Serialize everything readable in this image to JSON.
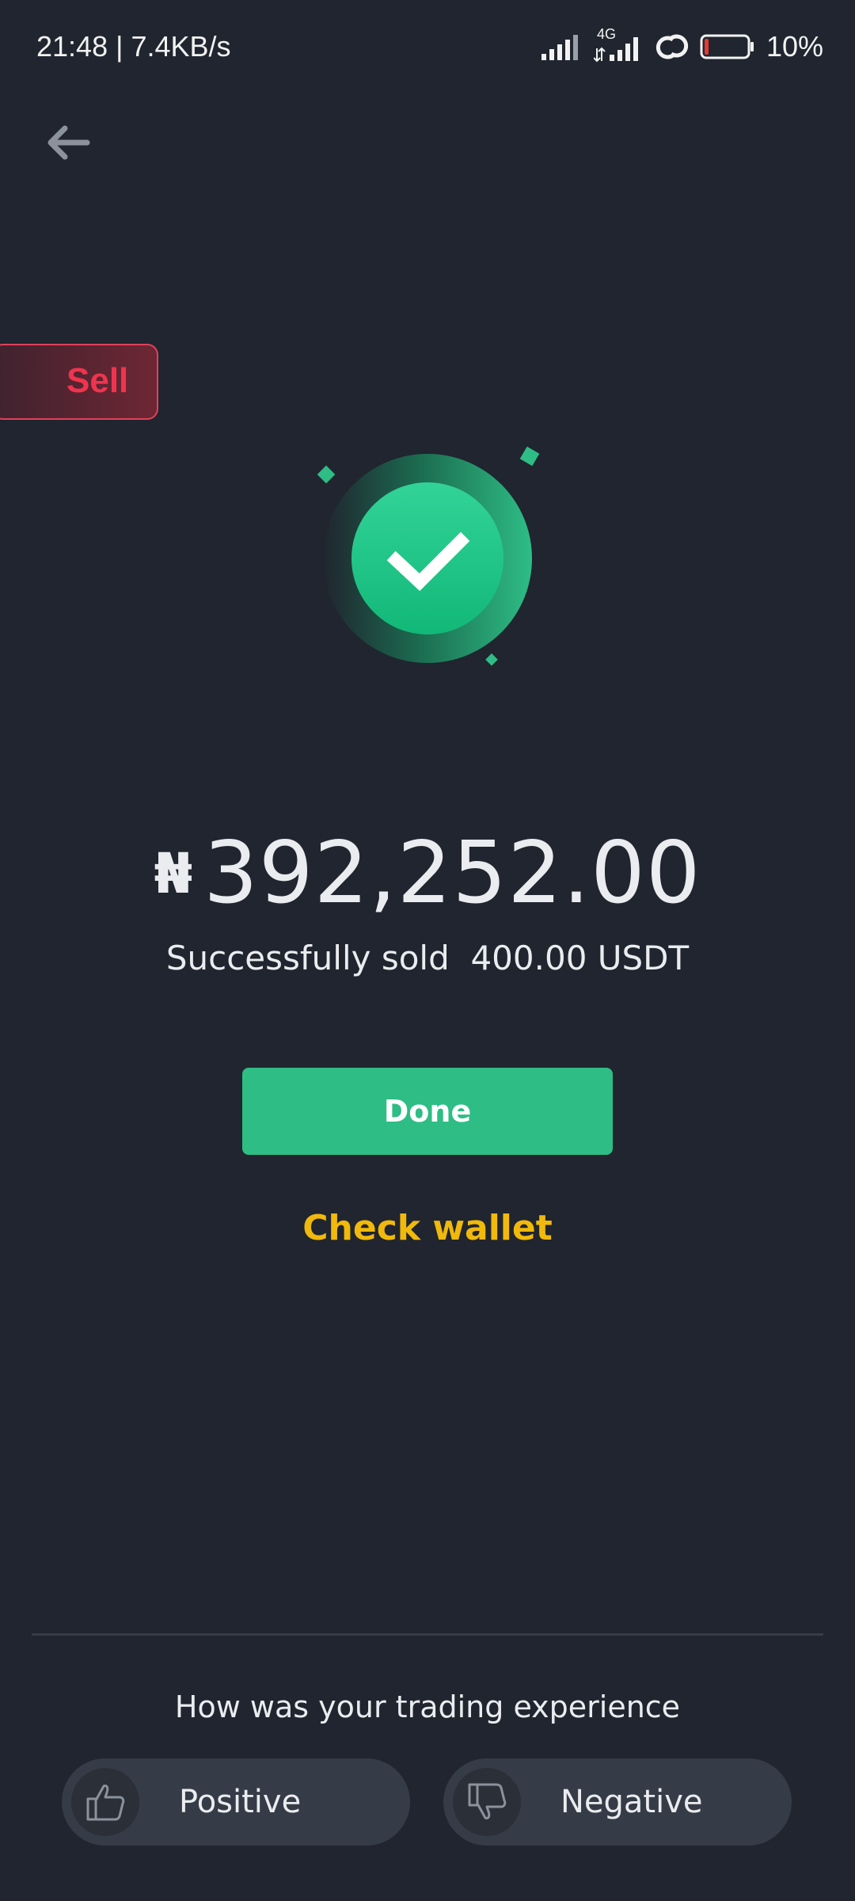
{
  "status_bar": {
    "time_speed": "21:48 | 7.4KB/s",
    "network": "4G",
    "battery": "10%"
  },
  "tag": {
    "label": "Sell"
  },
  "result": {
    "currency_symbol": "₦",
    "amount": "392,252.00",
    "message": "Successfully sold  400.00 USDT"
  },
  "actions": {
    "done_label": "Done",
    "check_wallet_label": "Check wallet"
  },
  "feedback": {
    "question": "How was your trading experience",
    "positive_label": "Positive",
    "negative_label": "Negative"
  },
  "colors": {
    "background": "#20252f",
    "success_green": "#2ebd85",
    "accent_yellow": "#f0b90b",
    "sell_red": "#f0344e"
  },
  "icons": [
    "back-arrow-icon",
    "signal-icon",
    "link-icon",
    "battery-icon",
    "check-icon",
    "thumbs-up-icon",
    "thumbs-down-icon"
  ]
}
